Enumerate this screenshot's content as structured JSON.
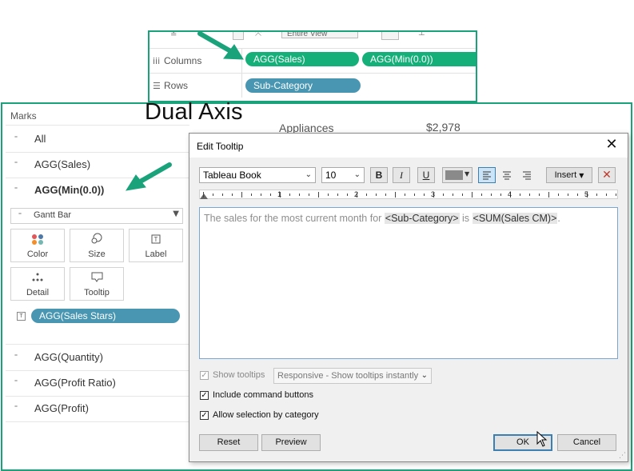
{
  "overlay": {
    "dual_axis_label": "Dual Axis",
    "accent_color": "#1aa37a"
  },
  "shelves": {
    "columns_label": "Columns",
    "rows_label": "Rows",
    "columns_pills": [
      "AGG(Sales)",
      "AGG(Min(0.0))"
    ],
    "rows_pills": [
      "Sub-Category"
    ],
    "toolbar_partial_text": "Entire View"
  },
  "marks": {
    "header": "Marks",
    "cards": [
      "All",
      "AGG(Sales)",
      "AGG(Min(0.0))"
    ],
    "mark_type": "Gantt Bar",
    "buttons": [
      "Color",
      "Size",
      "Label",
      "Detail",
      "Tooltip"
    ],
    "label_pill": "AGG(Sales Stars)",
    "more_cards": [
      "AGG(Quantity)",
      "AGG(Profit Ratio)",
      "AGG(Profit)"
    ]
  },
  "view": {
    "row_label": "Appliances",
    "row_value": "$2,978"
  },
  "dialog": {
    "title": "Edit Tooltip",
    "font_family": "Tableau Book",
    "font_size": "10",
    "bold": "B",
    "italic": "I",
    "underline": "U",
    "insert_label": "Insert",
    "ruler_numbers": [
      "1",
      "2",
      "3",
      "4",
      "5"
    ],
    "text_prefix": "The sales for the most current month for ",
    "token_1": "<Sub-Category>",
    "text_mid": " is ",
    "token_2": "<SUM(Sales CM)>",
    "text_suffix": ".",
    "show_tooltips_label": "Show tooltips",
    "tooltip_mode": "Responsive - Show tooltips instantly",
    "include_command_buttons_label": "Include command buttons",
    "allow_selection_label": "Allow selection by category",
    "reset_label": "Reset",
    "preview_label": "Preview",
    "ok_label": "OK",
    "cancel_label": "Cancel",
    "checked": {
      "show_tooltips": true,
      "include_command_buttons": true,
      "allow_selection": true
    }
  }
}
